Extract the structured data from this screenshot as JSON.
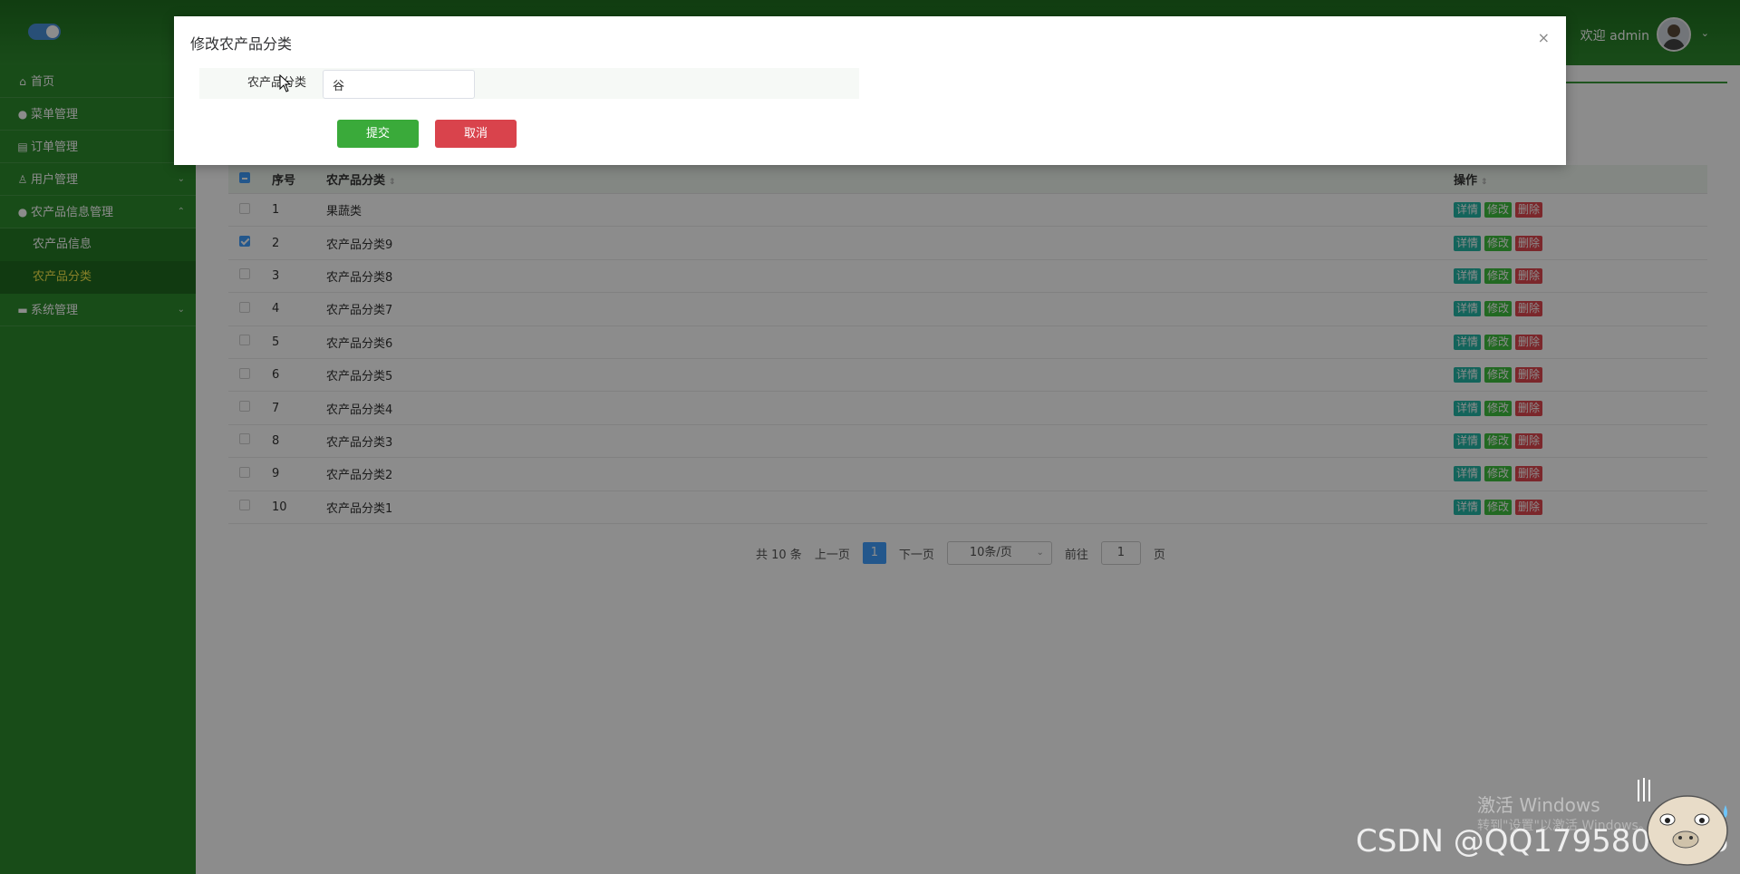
{
  "header": {
    "welcome_text": "欢迎 admin",
    "caret": "⌄"
  },
  "sidebar": {
    "items": [
      {
        "icon": "⌂",
        "label": "首页",
        "caret": ""
      },
      {
        "icon": "●",
        "label": "菜单管理",
        "caret": ""
      },
      {
        "icon": "▤",
        "label": "订单管理",
        "caret": ""
      },
      {
        "icon": "♙",
        "label": "用户管理",
        "caret": "⌄"
      },
      {
        "icon": "●",
        "label": "农产品信息管理",
        "caret": "⌃"
      },
      {
        "icon": "▬",
        "label": "系统管理",
        "caret": "⌄"
      }
    ],
    "subitems": [
      {
        "label": "农产品信息"
      },
      {
        "label": "农产品分类"
      }
    ]
  },
  "table": {
    "headers": {
      "index": "序号",
      "name": "农产品分类",
      "ops": "操作",
      "sort": "⇕"
    },
    "op_labels": {
      "detail": "详情",
      "edit": "修改",
      "delete": "删除"
    },
    "rows": [
      {
        "index": "1",
        "name": "果蔬类",
        "checked": false
      },
      {
        "index": "2",
        "name": "农产品分类9",
        "checked": true
      },
      {
        "index": "3",
        "name": "农产品分类8",
        "checked": false
      },
      {
        "index": "4",
        "name": "农产品分类7",
        "checked": false
      },
      {
        "index": "5",
        "name": "农产品分类6",
        "checked": false
      },
      {
        "index": "6",
        "name": "农产品分类5",
        "checked": false
      },
      {
        "index": "7",
        "name": "农产品分类4",
        "checked": false
      },
      {
        "index": "8",
        "name": "农产品分类3",
        "checked": false
      },
      {
        "index": "9",
        "name": "农产品分类2",
        "checked": false
      },
      {
        "index": "10",
        "name": "农产品分类1",
        "checked": false
      }
    ]
  },
  "pagination": {
    "total": "共 10 条",
    "prev": "上一页",
    "current": "1",
    "next": "下一页",
    "page_size": "10条/页",
    "goto_label": "前往",
    "goto_value": "1",
    "goto_suffix": "页"
  },
  "dialog": {
    "title": "修改农产品分类",
    "close": "×",
    "field_label": "农产品分类",
    "field_value": "谷",
    "submit": "提交",
    "cancel": "取消"
  },
  "watermark": {
    "windows_title": "激活 Windows",
    "windows_sub": "转到\"设置\"以激活 Windows。",
    "csdn": "CSDN @QQ1795806396"
  }
}
